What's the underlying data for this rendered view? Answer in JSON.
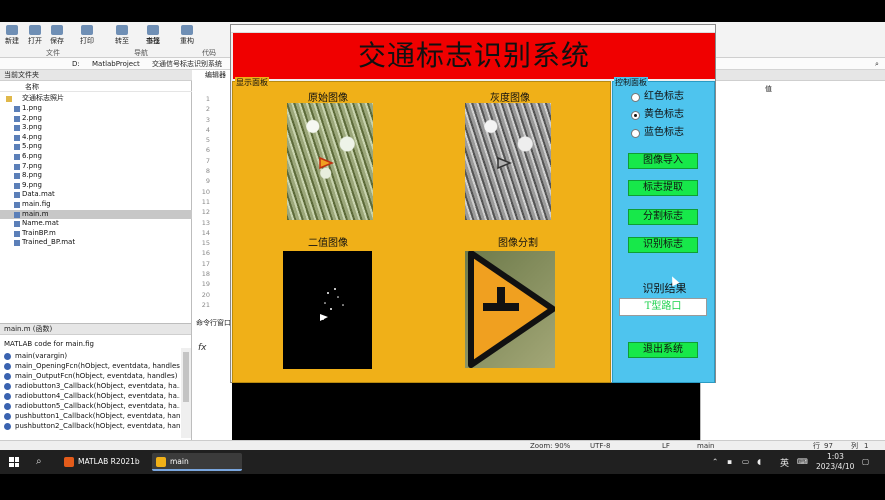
{
  "ribbon": {
    "buttons": [
      "新建",
      "打开",
      "保存",
      "打印",
      "转至",
      "查找",
      "书签",
      "重构",
      "代码"
    ],
    "sections": [
      "文件",
      "导航",
      "代码"
    ]
  },
  "address": {
    "path": [
      "D:",
      "MatlabProject",
      "交通信号标志识别系统"
    ]
  },
  "file_browser": {
    "title": "当前文件夹",
    "column": "名称",
    "folder": "交通标志照片",
    "files": [
      "1.png",
      "2.png",
      "3.png",
      "4.png",
      "5.png",
      "6.png",
      "7.png",
      "8.png",
      "9.png",
      "Data.mat",
      "main.fig",
      "main.m",
      "Name.mat",
      "TrainBP.m",
      "Trained_BP.mat"
    ],
    "selected": "main.m"
  },
  "details": {
    "header": "main.m (函数)",
    "description": "MATLAB code for main.fig",
    "functions": [
      "main(varargin)",
      "main_OpeningFcn(hObject, eventdata, handles...",
      "main_OutputFcn(hObject, eventdata, handles)",
      "radiobutton3_Callback(hObject, eventdata, ha...",
      "radiobutton4_Callback(hObject, eventdata, ha...",
      "radiobutton5_Callback(hObject, eventdata, ha...",
      "pushbutton1_Callback(hObject, eventdata, han...",
      "pushbutton2_Callback(hObject, eventdata, han..."
    ]
  },
  "editor": {
    "tab": "编辑器",
    "line_numbers": [
      "1",
      "2",
      "3",
      "4",
      "5",
      "6",
      "7",
      "8",
      "9",
      "10",
      "11",
      "12",
      "13",
      "14",
      "15",
      "16",
      "17",
      "18",
      "19",
      "20",
      "21"
    ],
    "command_window": "命令行窗口",
    "prompt": "fx"
  },
  "workspace": {
    "title": "区",
    "column": "值"
  },
  "statusbar": {
    "zoom": "Zoom: 90%",
    "encoding": "UTF-8",
    "eol": "LF",
    "file": "main",
    "row_label": "行",
    "row": "97",
    "col_label": "列",
    "col": "1"
  },
  "taskbar": {
    "apps": [
      {
        "label": "MATLAB R2021b",
        "color": "#e35b1a"
      },
      {
        "label": "main",
        "color": "#f0b018"
      }
    ],
    "ime": "英",
    "time": "1:03",
    "date": "2023/4/10"
  },
  "gui": {
    "title": "交通标志识别系统",
    "display_panel": {
      "legend": "显示面板",
      "images": [
        {
          "caption": "原始图像"
        },
        {
          "caption": "灰度图像"
        },
        {
          "caption": "二值图像"
        },
        {
          "caption": "图像分割"
        }
      ]
    },
    "control_panel": {
      "legend": "控制面板",
      "radios": [
        {
          "label": "红色标志",
          "selected": false
        },
        {
          "label": "黄色标志",
          "selected": true
        },
        {
          "label": "蓝色标志",
          "selected": false
        }
      ],
      "buttons": [
        "图像导入",
        "标志提取",
        "分割标志",
        "识别标志"
      ],
      "result_label": "识别结果",
      "result_value": "T型路口",
      "exit_button": "退出系统"
    },
    "colors": {
      "banner": "#f00000",
      "display_panel": "#f0b018",
      "control_panel": "#4ec4ee",
      "button": "#17e84a",
      "result_text": "#19d04a"
    }
  }
}
